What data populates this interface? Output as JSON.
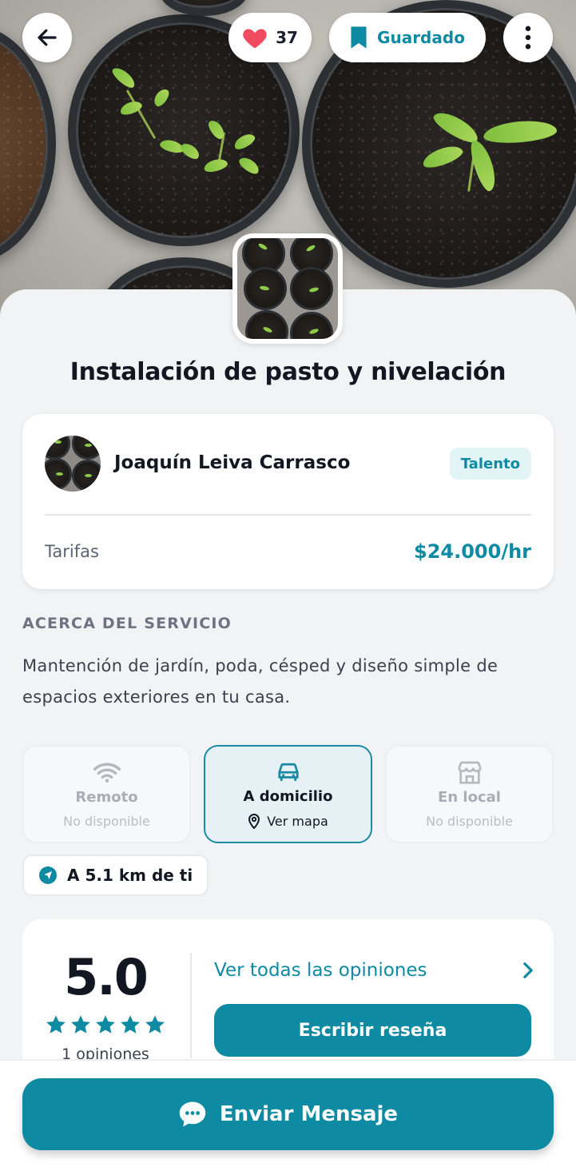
{
  "header": {
    "likes_count": "37",
    "saved_label": "Guardado"
  },
  "service": {
    "title": "Instalación de pasto y nivelación"
  },
  "provider": {
    "name": "Joaquín Leiva Carrasco",
    "badge": "Talento",
    "rate_label": "Tarifas",
    "rate_value": "$24.000/hr"
  },
  "about": {
    "heading": "ACERCA DEL SERVICIO",
    "description": "Mantención de jardín, poda, césped y diseño simple de espacios exteriores en tu casa."
  },
  "modalities": [
    {
      "title": "Remoto",
      "subtitle": "No disponible",
      "icon": "wifi-icon",
      "active": false
    },
    {
      "title": "A domicilio",
      "subtitle": "Ver mapa",
      "icon": "car-icon",
      "active": true
    },
    {
      "title": "En local",
      "subtitle": "No disponible",
      "icon": "store-icon",
      "active": false
    }
  ],
  "distance": {
    "label": "A 5.1 km de ti"
  },
  "reviews": {
    "score": "5.0",
    "stars": 5,
    "count_label": "1 opiniones",
    "all_link": "Ver todas las opiniones",
    "write_button": "Escribir reseña"
  },
  "footer": {
    "send_button": "Enviar Mensaje"
  },
  "colors": {
    "accent": "#0e8aa3",
    "accent_light": "#e3f4f6",
    "like_heart": "#f04b5e",
    "background": "#f2f3f5"
  }
}
